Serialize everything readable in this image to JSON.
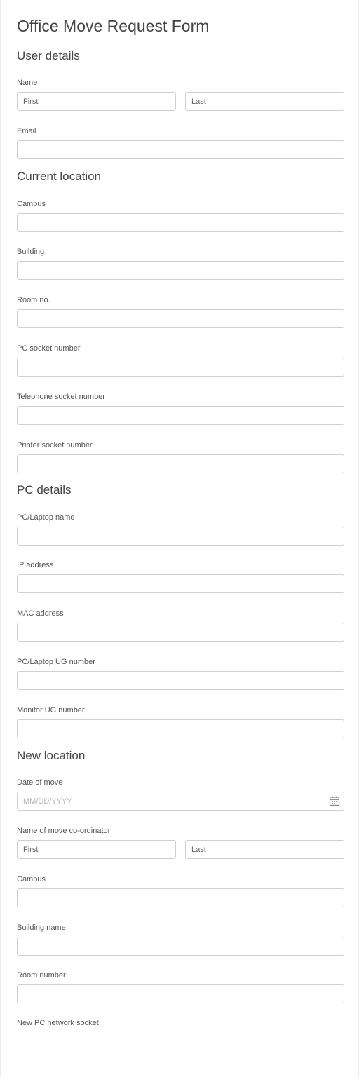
{
  "form": {
    "title": "Office Move Request Form"
  },
  "user_details": {
    "heading": "User details",
    "name_label": "Name",
    "first_placeholder": "First",
    "last_placeholder": "Last",
    "email_label": "Email"
  },
  "current_location": {
    "heading": "Current location",
    "campus_label": "Campus",
    "building_label": "Building",
    "room_label": "Room no.",
    "pc_socket_label": "PC socket number",
    "telephone_socket_label": "Telephone socket number",
    "printer_socket_label": "Printer socket number"
  },
  "pc_details": {
    "heading": "PC details",
    "pc_name_label": "PC/Laptop name",
    "ip_label": "IP address",
    "mac_label": "MAC address",
    "pc_ug_label": "PC/Laptop UG number",
    "monitor_ug_label": "Monitor UG number"
  },
  "new_location": {
    "heading": "New location",
    "date_label": "Date of move",
    "date_placeholder": "MM/DD/YYYY",
    "date_icon": "calendar-icon",
    "coordinator_label": "Name of move co-ordinator",
    "first_placeholder": "First",
    "last_placeholder": "Last",
    "campus_label": "Campus",
    "building_label": "Building name",
    "room_label": "Room number",
    "pc_socket_label": "New PC network socket"
  },
  "colors": {
    "border": "#cfcfcf",
    "text": "#333333",
    "heading": "#444444"
  }
}
